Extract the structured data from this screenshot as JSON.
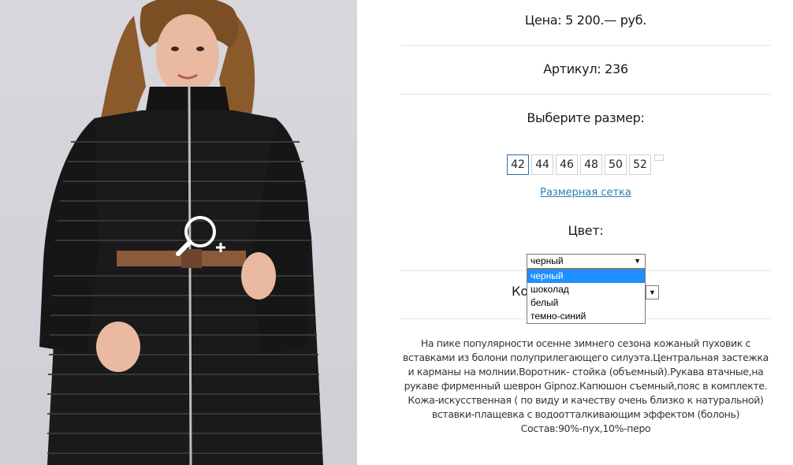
{
  "product": {
    "price": "Цена: 5 200.— руб.",
    "article": "Артикул: 236"
  },
  "size_section": {
    "title": "Выберите размер:",
    "sizes": [
      "42",
      "44",
      "46",
      "48",
      "50",
      "52"
    ],
    "selected": "42",
    "chart_link": "Размерная сетка"
  },
  "color_section": {
    "title": "Цвет:",
    "selected": "черный",
    "options": [
      "черный",
      "шоколад",
      "белый",
      "темно-синий"
    ]
  },
  "quantity_section": {
    "label_visible": "Ко"
  },
  "description": {
    "lines": [
      "На пике популярности осенне зимнего сезона кожаный пуховик с",
      "вставками из болони полуприлегающего силуэта.Центральная застежка",
      "и карманы на молнии.Воротник- стойка (объемный).Рукава втачные,на",
      "рукаве фирменный шеврон Gipnoz.Капюшон съемный,пояс в комплекте.",
      "Кожа-искусственная ( по виду и качеству очень близко к натуральной)",
      "вставки-плащевка с водоотталкивающим эффектом (болонь)",
      "Состав:90%-пух,10%-перо"
    ]
  },
  "icons": {
    "zoom": "zoom-in-icon",
    "dropdown_arrow": "▼"
  },
  "colors": {
    "link": "#2a7fb5",
    "selected_border": "#2a6fb0",
    "dropdown_highlight": "#1e90ff",
    "photo_background": "#d4d4da"
  }
}
